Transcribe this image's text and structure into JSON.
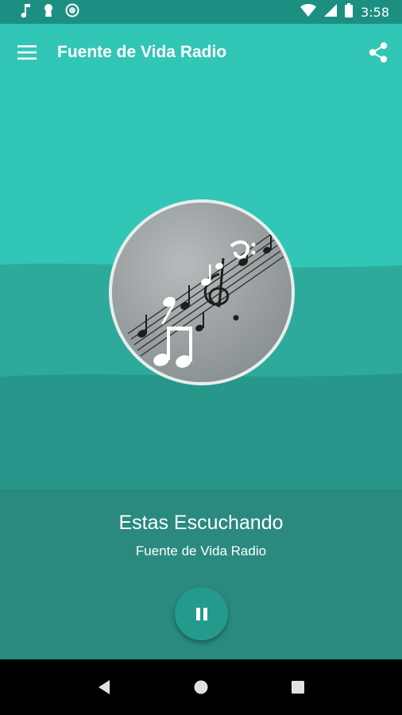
{
  "status_bar": {
    "time": "3:58",
    "left_icons": [
      "music-note-icon",
      "keyhole-icon",
      "sync-circle-icon"
    ],
    "right_icons": [
      "wifi-icon",
      "signal-icon",
      "battery-icon"
    ]
  },
  "app_bar": {
    "title": "Fuente de Vida Radio",
    "menu_icon": "hamburger-menu-icon",
    "share_icon": "share-icon"
  },
  "player": {
    "now_playing_label": "Estas Escuchando",
    "station_name": "Fuente de Vida Radio",
    "control_icon": "pause-icon"
  },
  "nav_bar": {
    "buttons": [
      "back-icon",
      "home-icon",
      "recents-icon"
    ]
  },
  "colors": {
    "primary": "#31c6b6",
    "primary_dark": "#1d8f82",
    "panel": "#2a8a7f",
    "fab": "#249a8d"
  }
}
